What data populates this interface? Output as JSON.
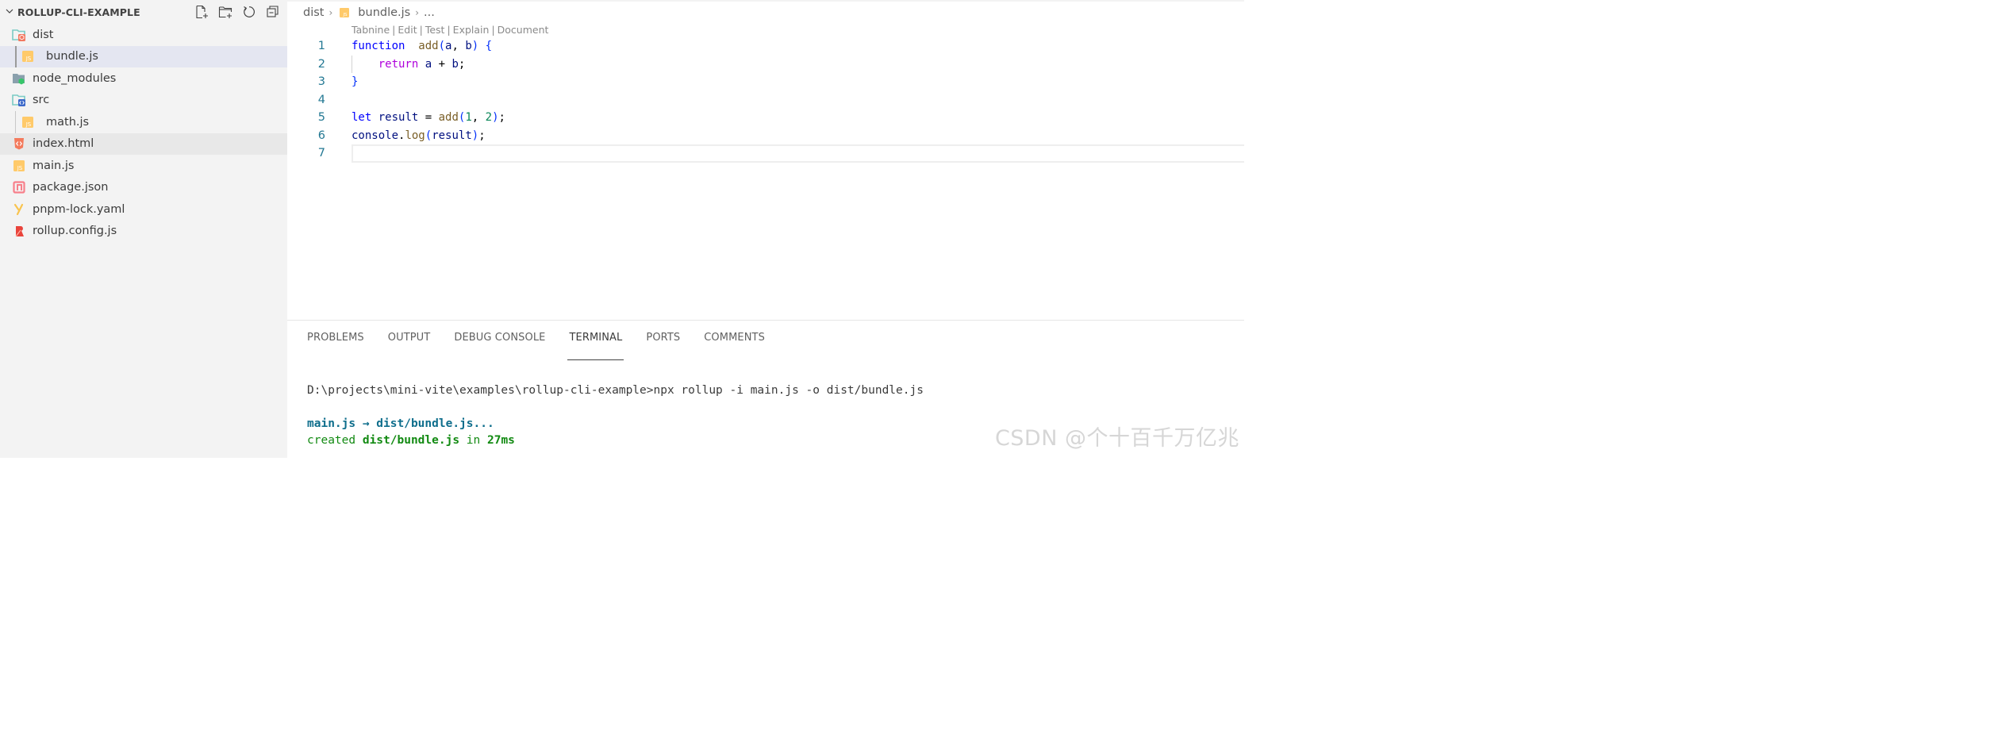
{
  "sidebar": {
    "title": "ROLLUP-CLI-EXAMPLE",
    "actions": [
      {
        "name": "new-file",
        "label": "New File"
      },
      {
        "name": "new-folder",
        "label": "New Folder"
      },
      {
        "name": "refresh",
        "label": "Refresh Explorer"
      },
      {
        "name": "collapse-all",
        "label": "Collapse Folders"
      }
    ],
    "tree": [
      {
        "label": "dist",
        "kind": "folder",
        "icon": "folder-dist-icon",
        "depth": 0,
        "state": ""
      },
      {
        "label": "bundle.js",
        "kind": "file",
        "icon": "js-file-icon",
        "depth": 1,
        "state": "selected"
      },
      {
        "label": "node_modules",
        "kind": "folder",
        "icon": "folder-node-icon",
        "depth": 0,
        "state": ""
      },
      {
        "label": "src",
        "kind": "folder",
        "icon": "folder-src-icon",
        "depth": 0,
        "state": ""
      },
      {
        "label": "math.js",
        "kind": "file",
        "icon": "js-file-icon",
        "depth": 1,
        "state": ""
      },
      {
        "label": "index.html",
        "kind": "file",
        "icon": "html-file-icon",
        "depth": 0,
        "state": "hover"
      },
      {
        "label": "main.js",
        "kind": "file",
        "icon": "js-file-icon",
        "depth": 0,
        "state": ""
      },
      {
        "label": "package.json",
        "kind": "file",
        "icon": "npm-file-icon",
        "depth": 0,
        "state": ""
      },
      {
        "label": "pnpm-lock.yaml",
        "kind": "file",
        "icon": "yaml-file-icon",
        "depth": 0,
        "state": ""
      },
      {
        "label": "rollup.config.js",
        "kind": "file",
        "icon": "rollup-file-icon",
        "depth": 0,
        "state": ""
      }
    ]
  },
  "editor": {
    "breadcrumb": {
      "folder": "dist",
      "file": "bundle.js",
      "more": "..."
    },
    "codelens": [
      "Tabnine",
      "Edit",
      "Test",
      "Explain",
      "Document"
    ],
    "lines": [
      {
        "n": "1",
        "tokens": [
          [
            "kw",
            "function"
          ],
          [
            "",
            "  "
          ],
          [
            "fn",
            "add"
          ],
          [
            "br",
            "("
          ],
          [
            "var",
            "a"
          ],
          [
            "",
            ", "
          ],
          [
            "var",
            "b"
          ],
          [
            "br",
            ")"
          ],
          [
            "",
            " "
          ],
          [
            "br",
            "{"
          ]
        ]
      },
      {
        "n": "2",
        "tokens": [
          [
            "",
            "    "
          ],
          [
            "kw-ctrl",
            "return"
          ],
          [
            "",
            " "
          ],
          [
            "var",
            "a"
          ],
          [
            "",
            " + "
          ],
          [
            "var",
            "b"
          ],
          [
            "",
            ";"
          ]
        ]
      },
      {
        "n": "3",
        "tokens": [
          [
            "br",
            "}"
          ]
        ]
      },
      {
        "n": "4",
        "tokens": []
      },
      {
        "n": "5",
        "tokens": [
          [
            "kw",
            "let"
          ],
          [
            "",
            " "
          ],
          [
            "var",
            "result"
          ],
          [
            "",
            " = "
          ],
          [
            "fn",
            "add"
          ],
          [
            "br",
            "("
          ],
          [
            "num",
            "1"
          ],
          [
            "",
            ", "
          ],
          [
            "num",
            "2"
          ],
          [
            "br",
            ")"
          ],
          [
            "",
            ";"
          ]
        ]
      },
      {
        "n": "6",
        "tokens": [
          [
            "var",
            "console"
          ],
          [
            "",
            "."
          ],
          [
            "fn",
            "log"
          ],
          [
            "br",
            "("
          ],
          [
            "var",
            "result"
          ],
          [
            "br",
            ")"
          ],
          [
            "",
            ";"
          ]
        ]
      },
      {
        "n": "7",
        "tokens": []
      }
    ],
    "current_line": "7"
  },
  "panel": {
    "tabs": [
      {
        "label": "PROBLEMS",
        "active": false
      },
      {
        "label": "OUTPUT",
        "active": false
      },
      {
        "label": "DEBUG CONSOLE",
        "active": false
      },
      {
        "label": "TERMINAL",
        "active": true
      },
      {
        "label": "PORTS",
        "active": false
      },
      {
        "label": "COMMENTS",
        "active": false
      }
    ],
    "terminal": {
      "prompt_line": "D:\\projects\\mini-vite\\examples\\rollup-cli-example>npx rollup -i main.js -o dist/bundle.js",
      "bundle_line": "main.js → dist/bundle.js...",
      "created_prefix": "created ",
      "created_target": "dist/bundle.js",
      "created_mid": " in ",
      "created_time": "27ms"
    }
  },
  "watermark": "CSDN @个十百千万亿兆"
}
